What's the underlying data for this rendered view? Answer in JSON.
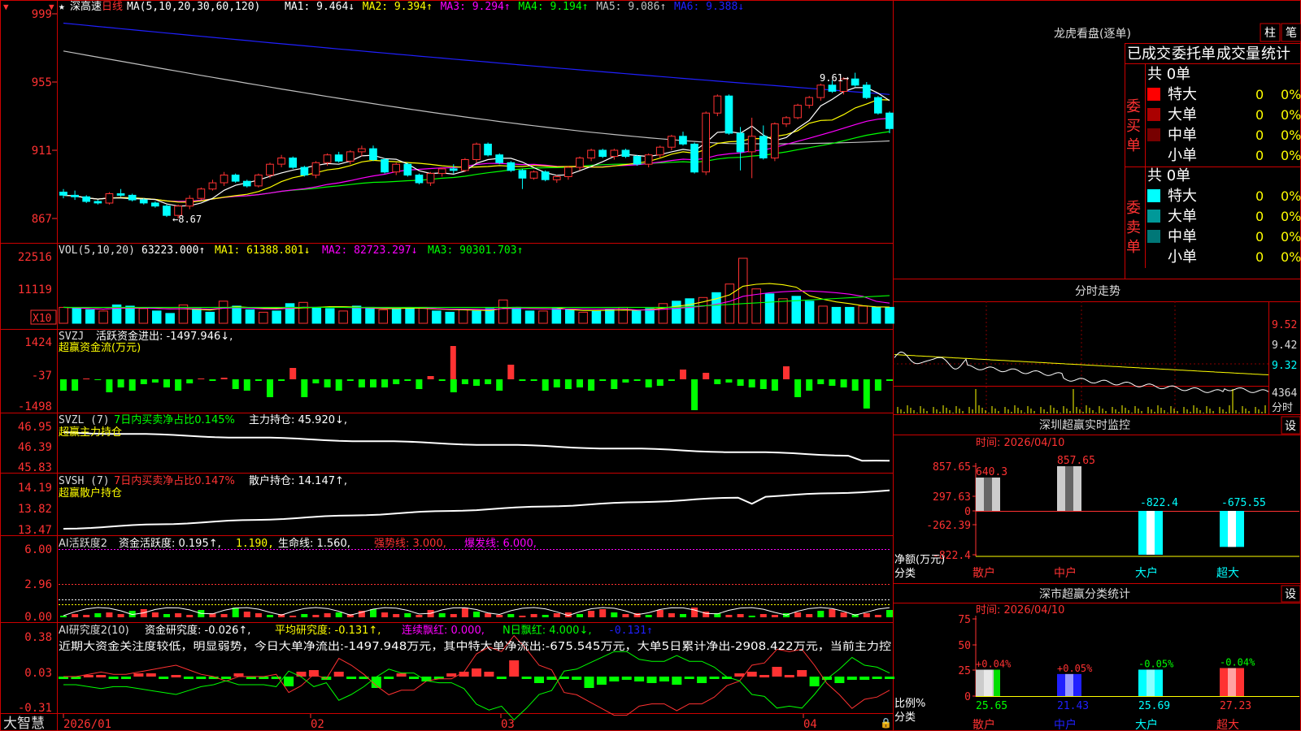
{
  "window": {
    "brand": "大智慧",
    "stock_name": "深高速",
    "period": "日线",
    "star": "★"
  },
  "colors": {
    "up": "#ff3232",
    "down": "#00ffff",
    "ma1": "#ffffff",
    "ma2": "#ffff00",
    "ma3": "#ff00ff",
    "ma4": "#00ff00",
    "ma5": "#c0c0c0",
    "ma6": "#2020ff",
    "frame": "#cc0000",
    "green_bar": "#00ff00"
  },
  "main_panel": {
    "ma_label": "MA(5,10,20,30,60,120)",
    "ma_values": [
      {
        "text": "MA1: 9.464↓",
        "color": "#ffffff"
      },
      {
        "text": "MA2: 9.394↑",
        "color": "#ffff00"
      },
      {
        "text": "MA3: 9.294↑",
        "color": "#ff00ff"
      },
      {
        "text": "MA4: 9.194↑",
        "color": "#00ff00"
      },
      {
        "text": "MA5: 9.086↑",
        "color": "#c0c0c0"
      },
      {
        "text": "MA6: 9.388↓",
        "color": "#2020ff"
      }
    ],
    "y_ticks": [
      "999",
      "955",
      "911",
      "867"
    ],
    "high_label": "9.61→",
    "low_label": "←8.67"
  },
  "chart_data": [
    {
      "type": "candlestick",
      "title": "深高速 日线",
      "ylim": [
        8.6,
        9.7
      ],
      "x": [
        "2026/01",
        "02",
        "03",
        "04"
      ],
      "ohlc": [
        [
          8.84,
          8.86,
          8.8,
          8.82
        ],
        [
          8.82,
          8.85,
          8.79,
          8.81
        ],
        [
          8.81,
          8.82,
          8.77,
          8.78
        ],
        [
          8.78,
          8.79,
          8.76,
          8.77
        ],
        [
          8.77,
          8.84,
          8.76,
          8.83
        ],
        [
          8.83,
          8.86,
          8.81,
          8.82
        ],
        [
          8.82,
          8.83,
          8.78,
          8.79
        ],
        [
          8.79,
          8.8,
          8.76,
          8.77
        ],
        [
          8.77,
          8.78,
          8.74,
          8.75
        ],
        [
          8.75,
          8.76,
          8.68,
          8.69
        ],
        [
          8.69,
          8.76,
          8.67,
          8.75
        ],
        [
          8.75,
          8.82,
          8.73,
          8.8
        ],
        [
          8.8,
          8.87,
          8.79,
          8.86
        ],
        [
          8.86,
          8.92,
          8.85,
          8.9
        ],
        [
          8.9,
          8.97,
          8.88,
          8.95
        ],
        [
          8.95,
          8.96,
          8.9,
          8.91
        ],
        [
          8.91,
          8.92,
          8.87,
          8.88
        ],
        [
          8.88,
          8.96,
          8.87,
          8.95
        ],
        [
          8.95,
          9.03,
          8.93,
          9.02
        ],
        [
          9.02,
          9.08,
          9.0,
          9.06
        ],
        [
          9.06,
          9.07,
          8.99,
          9.0
        ],
        [
          9.0,
          9.01,
          8.94,
          8.95
        ],
        [
          8.95,
          9.04,
          8.93,
          9.03
        ],
        [
          9.03,
          9.09,
          9.01,
          9.08
        ],
        [
          9.08,
          9.1,
          9.03,
          9.04
        ],
        [
          9.04,
          9.11,
          9.02,
          9.1
        ],
        [
          9.1,
          9.14,
          9.07,
          9.12
        ],
        [
          9.12,
          9.14,
          9.04,
          9.05
        ],
        [
          9.05,
          9.06,
          8.96,
          8.97
        ],
        [
          8.97,
          9.03,
          8.95,
          9.02
        ],
        [
          9.02,
          9.03,
          8.94,
          8.95
        ],
        [
          8.95,
          8.96,
          8.89,
          8.9
        ],
        [
          8.9,
          8.97,
          8.88,
          8.96
        ],
        [
          8.96,
          9.0,
          8.94,
          8.99
        ],
        [
          8.99,
          9.02,
          8.96,
          8.98
        ],
        [
          8.98,
          9.06,
          8.97,
          9.05
        ],
        [
          9.05,
          9.16,
          9.03,
          9.15
        ],
        [
          9.15,
          9.16,
          9.07,
          9.08
        ],
        [
          9.08,
          9.09,
          9.02,
          9.03
        ],
        [
          9.03,
          9.04,
          8.97,
          8.98
        ],
        [
          8.98,
          8.99,
          8.86,
          8.93
        ],
        [
          8.93,
          8.98,
          8.92,
          8.97
        ],
        [
          8.97,
          8.98,
          8.91,
          8.92
        ],
        [
          8.92,
          8.95,
          8.9,
          8.94
        ],
        [
          8.94,
          9.01,
          8.92,
          9.0
        ],
        [
          9.0,
          9.07,
          8.98,
          9.06
        ],
        [
          9.06,
          9.12,
          9.04,
          9.11
        ],
        [
          9.11,
          9.12,
          9.06,
          9.07
        ],
        [
          9.07,
          9.12,
          9.05,
          9.11
        ],
        [
          9.11,
          9.12,
          9.06,
          9.07
        ],
        [
          9.07,
          9.08,
          9.01,
          9.02
        ],
        [
          9.02,
          9.09,
          9.0,
          9.08
        ],
        [
          9.08,
          9.14,
          9.06,
          9.13
        ],
        [
          9.13,
          9.21,
          9.11,
          9.2
        ],
        [
          9.2,
          9.23,
          9.14,
          9.15
        ],
        [
          9.15,
          9.16,
          8.96,
          8.97
        ],
        [
          8.97,
          9.36,
          8.95,
          9.35
        ],
        [
          9.35,
          9.47,
          9.33,
          9.46
        ],
        [
          9.46,
          9.47,
          9.21,
          9.22
        ],
        [
          9.22,
          9.26,
          8.98,
          9.1
        ],
        [
          9.1,
          9.32,
          8.93,
          9.2
        ],
        [
          9.2,
          9.27,
          9.05,
          9.06
        ],
        [
          9.06,
          9.29,
          9.04,
          9.28
        ],
        [
          9.28,
          9.33,
          9.26,
          9.32
        ],
        [
          9.32,
          9.41,
          9.31,
          9.4
        ],
        [
          9.4,
          9.46,
          9.38,
          9.45
        ],
        [
          9.45,
          9.54,
          9.43,
          9.53
        ],
        [
          9.53,
          9.56,
          9.48,
          9.49
        ],
        [
          9.49,
          9.58,
          9.47,
          9.57
        ],
        [
          9.57,
          9.61,
          9.52,
          9.53
        ],
        [
          9.53,
          9.55,
          9.44,
          9.45
        ],
        [
          9.45,
          9.46,
          9.34,
          9.35
        ],
        [
          9.35,
          9.36,
          9.22,
          9.25
        ]
      ],
      "ma_series": [
        {
          "name": "MA1",
          "start": [
            8.84
          ],
          "end": 9.464
        },
        {
          "name": "MA2",
          "end": 9.394
        },
        {
          "name": "MA3",
          "end": 9.294
        },
        {
          "name": "MA4",
          "end": 9.194
        },
        {
          "name": "MA5",
          "end": 9.086
        },
        {
          "name": "MA6",
          "end": 9.388
        }
      ]
    },
    {
      "type": "bar",
      "title": "VOL(5,10,20)",
      "values_x10": [
        13000,
        12000,
        11000,
        10000,
        15000,
        14000,
        12000,
        10000,
        8000,
        15000,
        12000,
        9000,
        18000,
        14000,
        11000,
        9000,
        10000,
        16000,
        17000,
        13000,
        12000,
        10000,
        14000,
        13000,
        11000,
        12000,
        12000,
        13000,
        10000,
        9000,
        11000,
        10000,
        12000,
        19000,
        13000,
        10000,
        10000,
        12000,
        11000,
        9000,
        10000,
        11000,
        13000,
        10000,
        12000,
        16000,
        18000,
        20000,
        21000,
        25000,
        32000,
        53000,
        28000,
        24000,
        20000,
        22000,
        18000,
        14000,
        13000,
        13000,
        14000,
        13000,
        13000
      ],
      "y_ticks": [
        "22516",
        "11119",
        "X10"
      ]
    }
  ],
  "vol_panel": {
    "label": "VOL(5,10,20)",
    "vol_value": "63223.000↑",
    "ma1": "MA1: 61388.801↓",
    "ma2": "MA2: 82723.297↓",
    "ma3": "MA3: 90301.703↑",
    "y_ticks": [
      "22516",
      "11119"
    ],
    "x10": "X10"
  },
  "svzj_panel": {
    "label": "SVZJ",
    "value_text": "活跃资金进出: -1497.946↓,",
    "subtitle": "超赢资金流(万元)",
    "y_ticks": [
      "1424",
      "-37",
      "-1498"
    ]
  },
  "svzl_panel": {
    "label": "SVZL (7)",
    "net_text": "7日内买卖净占比0.145%",
    "hold_text": "主力持仓: 45.920↓,",
    "subtitle": "超赢主力持仓",
    "y_ticks": [
      "46.95",
      "46.39",
      "45.83"
    ]
  },
  "svsh_panel": {
    "label": "SVSH (7)",
    "net_text": "7日内买卖净占比0.147%",
    "hold_text": "散户持仓: 14.147↑,",
    "subtitle": "超赢散户持仓",
    "y_ticks": [
      "14.19",
      "13.82",
      "13.47"
    ]
  },
  "ai_active_panel": {
    "label": "AI活跃度2",
    "t1": "资金活跃度: 0.195↑,",
    "t2": "1.190,",
    "t3": "生命线: 1.560,",
    "t4": "强势线: 3.000,",
    "t5": "爆发线: 6.000,",
    "y_ticks": [
      "6.00",
      "2.96",
      "0.00"
    ]
  },
  "ai_research_panel": {
    "label": "AI研究度2(10)",
    "t1": "资金研究度: -0.026↑,",
    "t2": "平均研究度: -0.131↑,",
    "t3": "连续飘红: 0.000,",
    "t4": "N日飘红: 4.000↓,",
    "t5": "-0.131↑",
    "comment": "近期大资金关注度较低，明显弱势，今日大单净流出:-1497.948万元，其中特大单净流出:-675.545万元，大单5日累计净出-2908.422万元，当前主力控",
    "y_ticks": [
      "0.38",
      "0.03",
      "-0.31"
    ]
  },
  "x_axis": {
    "labels": [
      "2026/01",
      "02",
      "03",
      "04"
    ]
  },
  "right_panel": {
    "lhkp_title": "龙虎看盘(逐单)",
    "btn_zhu": "柱",
    "btn_bi": "笔",
    "tabs": [
      "已成交",
      "委托单",
      "成交量",
      "统计"
    ],
    "buy": {
      "side_label": "委买单",
      "total": "共 0单",
      "rows": [
        {
          "name": "特大",
          "count": "0",
          "pct": "0%",
          "color": "#ff0000"
        },
        {
          "name": "大单",
          "count": "0",
          "pct": "0%",
          "color": "#aa0000"
        },
        {
          "name": "中单",
          "count": "0",
          "pct": "0%",
          "color": "#770000"
        },
        {
          "name": "小单",
          "count": "0",
          "pct": "0%",
          "color": "#000000"
        }
      ]
    },
    "sell": {
      "side_label": "委卖单",
      "total": "共 0单",
      "rows": [
        {
          "name": "特大",
          "count": "0",
          "pct": "0%",
          "color": "#00ffff"
        },
        {
          "name": "大单",
          "count": "0",
          "pct": "0%",
          "color": "#009999"
        },
        {
          "name": "中单",
          "count": "0",
          "pct": "0%",
          "color": "#007777"
        },
        {
          "name": "小单",
          "count": "0",
          "pct": "0%",
          "color": "#000000"
        }
      ]
    },
    "intraday_title": "分时走势",
    "intraday_ticks": [
      "9.52",
      "9.42",
      "9.32",
      "4364"
    ],
    "intraday_vol_label": "分时",
    "monitor_title": "深圳超赢实时监控",
    "settings": "设",
    "monitor_time": "时间: 2026/04/10",
    "monitor_y_ticks": [
      "857.65",
      "297.63",
      "0",
      "-262.39",
      "-822.4"
    ],
    "monitor_y_label": "净额(万元)",
    "monitor_x_label": "分类",
    "monitor_bars": [
      {
        "cat": "散户",
        "value": 640.3,
        "label": "640.3"
      },
      {
        "cat": "中户",
        "value": 857.65,
        "label": "857.65"
      },
      {
        "cat": "大户",
        "value": -822.4,
        "label": "-822.4"
      },
      {
        "cat": "超大",
        "value": -675.55,
        "label": "-675.55"
      }
    ],
    "class_title": "深市超赢分类统计",
    "class_time": "时间: 2026/04/10",
    "class_y_ticks": [
      "75",
      "50",
      "25",
      "0"
    ],
    "class_y_label": "比例%",
    "class_x_label": "分类",
    "class_bars": [
      {
        "cat": "散户",
        "value": 25.65,
        "change": "+0.04%",
        "label": "25.65"
      },
      {
        "cat": "中户",
        "value": 21.43,
        "change": "+0.05%",
        "label": "21.43"
      },
      {
        "cat": "大户",
        "value": 25.69,
        "change": "-0.05%",
        "label": "25.69"
      },
      {
        "cat": "超大",
        "value": 27.23,
        "change": "-0.04%",
        "label": "27.23"
      }
    ]
  }
}
